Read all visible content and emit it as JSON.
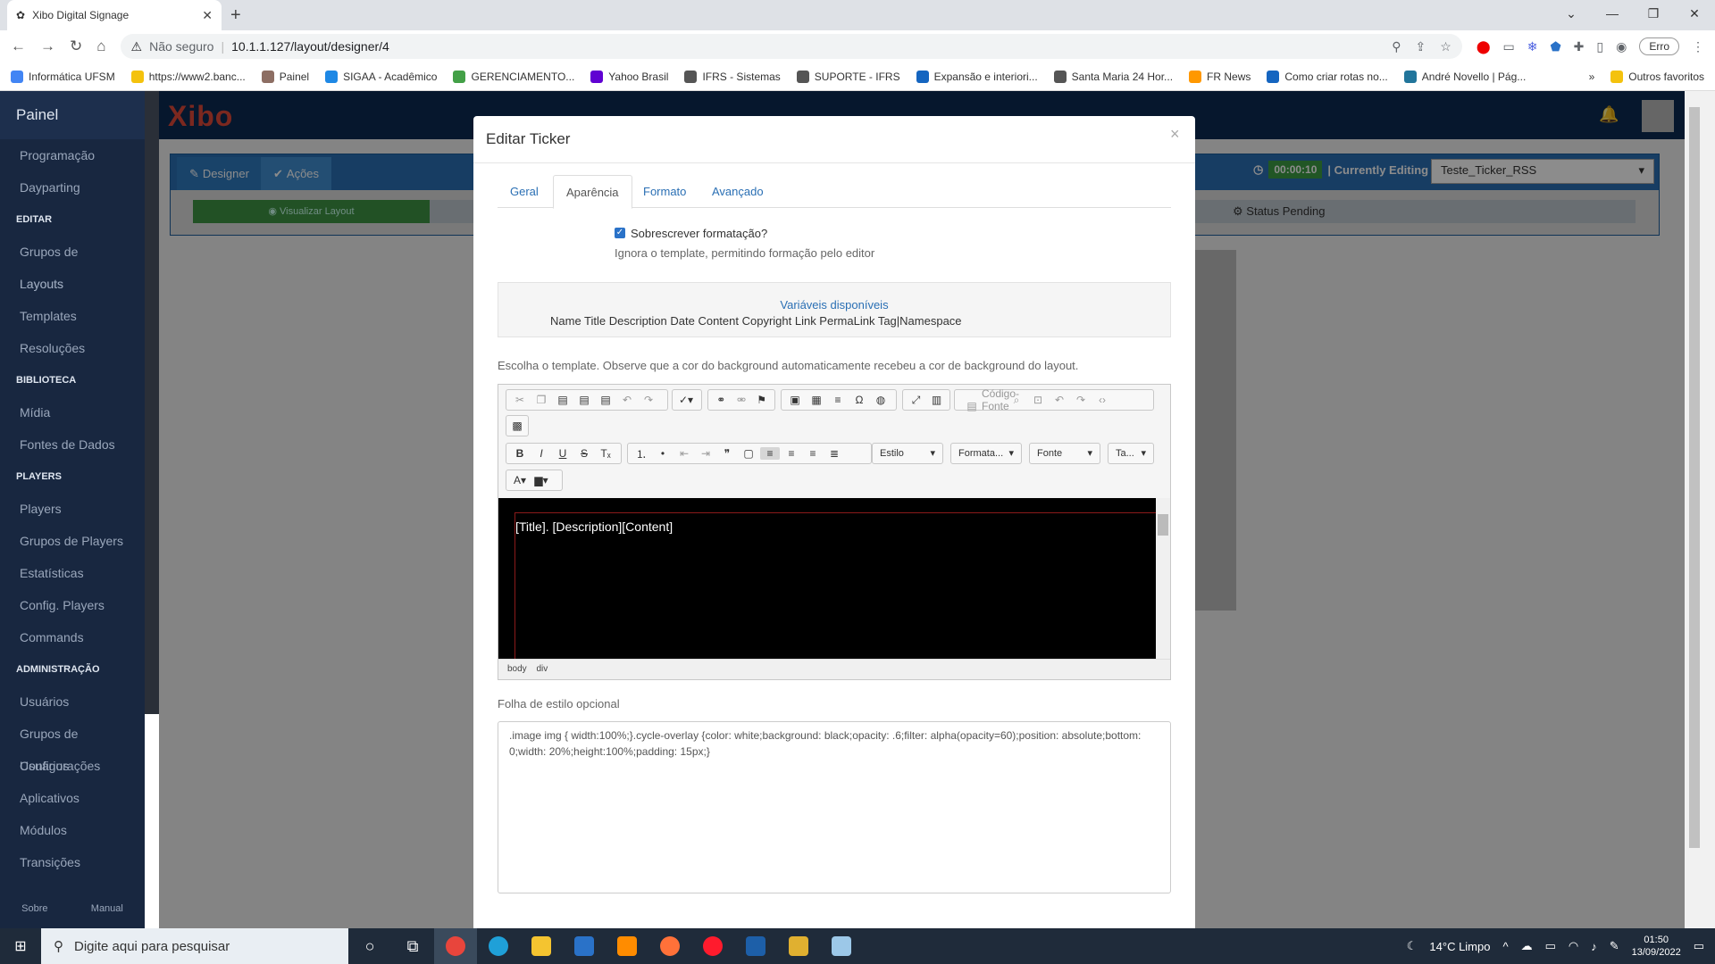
{
  "browser": {
    "tab_title": "Xibo Digital Signage",
    "url_warning": "Não seguro",
    "url": "10.1.1.127/layout/designer/4",
    "profile_button": "Erro",
    "bookmarks": [
      {
        "label": "Informática UFSM",
        "color": "#4285f4"
      },
      {
        "label": "https://www2.banc...",
        "color": "#f4c20d"
      },
      {
        "label": "Painel",
        "color": "#8d6e63"
      },
      {
        "label": "SIGAA - Acadêmico",
        "color": "#1e88e5"
      },
      {
        "label": "GERENCIAMENTO...",
        "color": "#43a047"
      },
      {
        "label": "Yahoo Brasil",
        "color": "#6001d2"
      },
      {
        "label": "IFRS - Sistemas",
        "color": "#555555"
      },
      {
        "label": "SUPORTE - IFRS",
        "color": "#555555"
      },
      {
        "label": "Expansão e interiori...",
        "color": "#1565c0"
      },
      {
        "label": "Santa Maria 24 Hor...",
        "color": "#555555"
      },
      {
        "label": "FR News",
        "color": "#ff9800"
      },
      {
        "label": "Como criar rotas no...",
        "color": "#1565c0"
      },
      {
        "label": "André Novello | Pág...",
        "color": "#21759b"
      }
    ],
    "other_bookmarks": "Outros favoritos"
  },
  "sidebar": {
    "brand": "Painel",
    "items": [
      {
        "label": "Programação",
        "type": "item"
      },
      {
        "label": "Dayparting",
        "type": "item"
      },
      {
        "label": "EDITAR",
        "type": "header"
      },
      {
        "label": "Grupos de Layouts",
        "type": "item"
      },
      {
        "label": "Layouts",
        "type": "item"
      },
      {
        "label": "Templates",
        "type": "item"
      },
      {
        "label": "Resoluções",
        "type": "item"
      },
      {
        "label": "BIBLIOTECA",
        "type": "header"
      },
      {
        "label": "Mídia",
        "type": "item"
      },
      {
        "label": "Fontes de Dados",
        "type": "item"
      },
      {
        "label": "PLAYERS",
        "type": "header"
      },
      {
        "label": "Players",
        "type": "item"
      },
      {
        "label": "Grupos de Players",
        "type": "item"
      },
      {
        "label": "Estatísticas",
        "type": "item"
      },
      {
        "label": "Config. Players",
        "type": "item"
      },
      {
        "label": "Commands",
        "type": "item"
      },
      {
        "label": "ADMINISTRAÇÃO",
        "type": "header"
      },
      {
        "label": "Usuários",
        "type": "item"
      },
      {
        "label": "Grupos de Usuários",
        "type": "item"
      },
      {
        "label": "Configurações",
        "type": "item"
      },
      {
        "label": "Aplicativos",
        "type": "item"
      },
      {
        "label": "Módulos",
        "type": "item"
      },
      {
        "label": "Transições",
        "type": "item"
      }
    ],
    "footer": {
      "about": "Sobre",
      "manual": "Manual"
    }
  },
  "app": {
    "logo": "Xibo",
    "tab_designer": "Designer",
    "tab_actions": "Ações",
    "timer": "00:00:10",
    "currently_editing": "| Currently Editing",
    "layout_name": "Teste_Ticker_RSS",
    "preview_button": "Visualizar Layout",
    "status": "Status Pending"
  },
  "modal": {
    "title": "Editar Ticker",
    "close": "×",
    "tabs": [
      "Geral",
      "Aparência",
      "Formato",
      "Avançado"
    ],
    "active_tab": "Aparência",
    "override_label": "Sobrescrever formatação?",
    "override_checked": true,
    "override_help": "Ignora o template, permitindo formação pelo editor",
    "vars_title": "Variáveis disponíveis",
    "vars_list": "Name Title Description Date Content Copyright Link PermaLink Tag|Namespace",
    "template_help": "Escolha o template. Observe que a cor do background automaticamente recebeu a cor de background do layout.",
    "editor": {
      "source_button": "Código-Fonte",
      "style_combo": "Estilo",
      "format_combo": "Formata...",
      "font_combo": "Fonte",
      "size_combo": "Ta...",
      "content": "[Title]. [Description][Content]",
      "path": "body div"
    },
    "css_label": "Folha de estilo opcional",
    "css_value": ".image img { width:100%;}.cycle-overlay {color: white;background: black;opacity: .6;filter: alpha(opacity=60);position: absolute;bottom: 0;width: 20%;height:100%;padding: 15px;}"
  },
  "taskbar": {
    "search_placeholder": "Digite aqui para pesquisar",
    "weather": "14°C  Limpo",
    "time": "01:50",
    "date": "13/09/2022"
  }
}
